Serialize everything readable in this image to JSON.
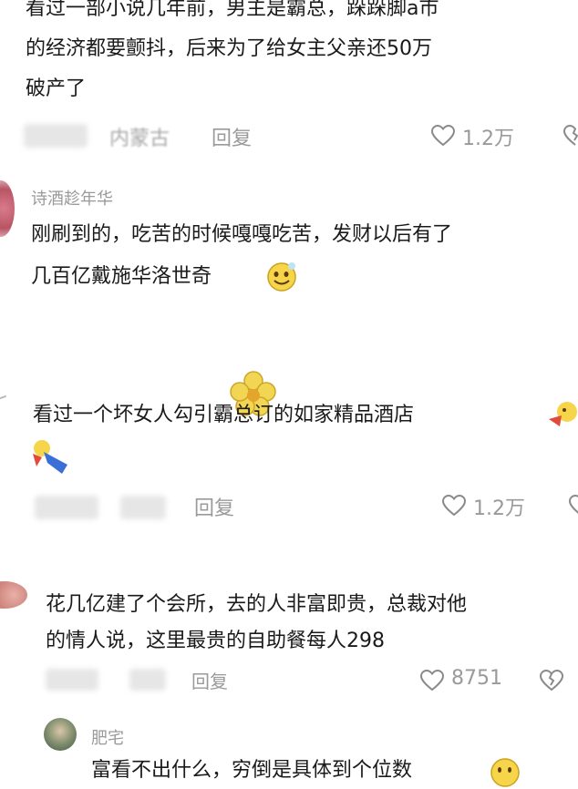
{
  "comments": [
    {
      "lines": [
        "看过一部小说几年前，男主是霸总，跺跺脚a市",
        "的经济都要颤抖，后来为了给女主父亲还50万",
        "破产了"
      ],
      "location": "内蒙古",
      "reply_label": "回复",
      "likes": "1.2万"
    },
    {
      "username": "诗酒趁年华",
      "lines": [
        "刚刷到的，吃苦的时候嘎嘎吃苦，发财以后有了",
        "几百亿戴施华洛世奇"
      ]
    },
    {
      "lines": [
        "看过一个坏女人勾引霸总订的如家精品酒店"
      ],
      "reply_label": "回复",
      "likes": "1.2万"
    },
    {
      "lines": [
        "花几亿建了个会所，去的人非富即贵，总裁对他",
        "的情人说，这里最贵的自助餐每人298"
      ],
      "reply_label": "回复",
      "likes": "8751"
    },
    {
      "username": "肥宅",
      "lines": [
        "富看不出什么，穷倒是具体到个位数"
      ]
    }
  ],
  "icons": {
    "like": "heart-outline-icon",
    "dislike": "broken-heart-icon",
    "emoji": "smiley-emoji",
    "watermark": "flower-watermark"
  },
  "colors": {
    "text": "#1a1a1a",
    "meta": "#a8a8a8",
    "username": "#9a9a9a",
    "watermark": "#e8c63a"
  }
}
